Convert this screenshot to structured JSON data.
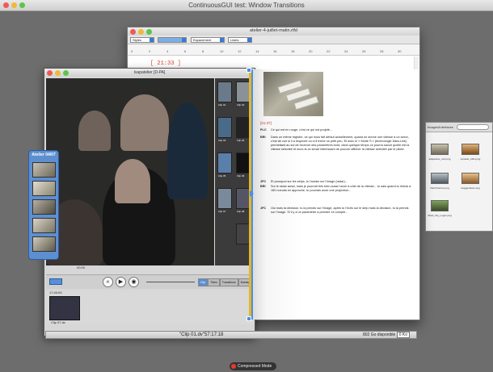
{
  "outer_window": {
    "title": "ContinuousGUI test: Window Transitions"
  },
  "document": {
    "title": "atelier-4-juillet-matin.rtfd",
    "toolbar": {
      "style": "Styles",
      "spacing": "Espacement",
      "lists": "Listes"
    },
    "ruler_ticks": [
      "0",
      "2",
      "4",
      "6",
      "8",
      "10",
      "12",
      "14",
      "16",
      "18",
      "20",
      "22",
      "24",
      "26",
      "28",
      "30"
    ],
    "timecode": "[ 21:33 ]",
    "page_timecode": "[21:37]",
    "dialogue": [
      {
        "speaker": "PLC",
        "text": "Ce qui est en rouge, c'est ce qui est projeté..."
      },
      {
        "speaker": "BRI",
        "text": "Dans un même registre, ce qui nous fait défaut actuellement, quand on donne une vitesse à un avion, c'est de voir si il a respecté ou si il triche un petit peu. Et avec le « Mode S » (technologie Data-Link) permettant au sol de recevoir des paramètres bord, dans quelque temps on pourra savoir quelle est la vitesse sélectée et donc là ce serait intéressant de pouvoir afficher la vitesse sélectée par le pilote."
      },
      {
        "speaker": "JFC",
        "text": "Et pourquoi sur les strips, tu l'aurais sur l'image (radar)..."
      },
      {
        "speaker": "BRI",
        "text": "Sur le radar aussi, mais je pourrait très bien aussi l'avoir à côté de la vitesse... tu sais quand tu réduis à 160 noeuds en approche, tu pourrais avoir une projection..."
      },
      {
        "speaker": "JFC",
        "text": "Oui mais ta décision, tu la prends sur l'image, après tu l'écris sur le strip mais la décision, tu la prends sur l'image. Si il y a un paramètre à prendre en compte..."
      }
    ]
  },
  "movie_window": {
    "title": "Isapatelier [D-PA]",
    "timecode_overlay": "00:00",
    "tabs": [
      "Clip",
      "Titres",
      "Transitions",
      "Montage",
      "Clip"
    ],
    "active_tab": 0,
    "thumb_captions": [
      "Clip 01",
      "Clip 02",
      "Clip 03",
      "Clip 04",
      "Clip 05",
      "Clip 06",
      "Clip 07",
      "Clip 08"
    ],
    "clip_time": "17:40:00",
    "clip_label": "Clip 07.dv",
    "status_clip": "\"Clip 01.dv\"57:17:18",
    "disk_free": "802 Go disponible",
    "disk_box": "0 Ko"
  },
  "files_window": {
    "title": "Images/Interfaces",
    "items": [
      "adapteline_mini.png",
      "carnetie_CRH.png",
      "DebrCherme.png",
      "GuggenHeim.png",
      "Shell_City_Logon.png"
    ]
  },
  "palette": {
    "title": "Atelier 04/07"
  },
  "badge": {
    "label": "Compressed Mode"
  }
}
